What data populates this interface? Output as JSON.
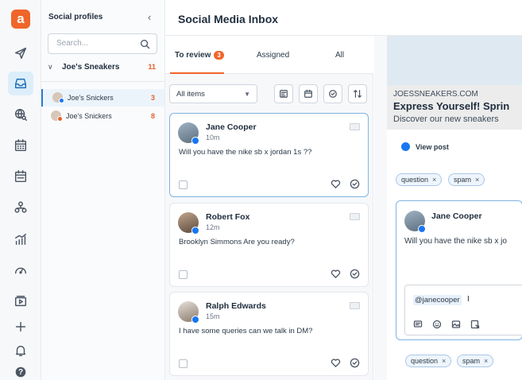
{
  "rail": {
    "logo": "a",
    "icons": [
      "send-icon",
      "inbox-icon",
      "globe-search-icon",
      "calendar-icon",
      "planner-icon",
      "team-icon",
      "analytics-icon",
      "gauge-icon",
      "media-icon",
      "plus-icon",
      "bell-icon",
      "help-icon"
    ],
    "active": "inbox-icon",
    "help_label": "?"
  },
  "profiles": {
    "title": "Social profiles",
    "search_placeholder": "Search...",
    "group": {
      "name": "Joe's Sneakers",
      "count": "11"
    },
    "items": [
      {
        "name": "Joe's Snickers",
        "count": "3",
        "network": "facebook"
      },
      {
        "name": "Joe's Snickers",
        "count": "8",
        "network": "instagram"
      }
    ]
  },
  "header": {
    "title": "Social Media Inbox"
  },
  "tabs": [
    {
      "label": "To review",
      "badge": "3"
    },
    {
      "label": "Assigned"
    },
    {
      "label": "All"
    }
  ],
  "filter": {
    "selected": "All items"
  },
  "messages": [
    {
      "name": "Jane Cooper",
      "time": "10m",
      "text": "Will you have the nike sb x jordan 1s ??"
    },
    {
      "name": "Robert Fox",
      "time": "12m",
      "text": "Brooklyn Simmons Are you ready?"
    },
    {
      "name": "Ralph Edwards",
      "time": "15m",
      "text": "I have some queries can we talk in DM?"
    }
  ],
  "detail": {
    "preview": {
      "domain": "JOESSNEAKERS.COM",
      "headline": "Express Yourself! Sprin",
      "subtitle": "Discover our new sneakers"
    },
    "view_post": "View post",
    "tags": [
      "question",
      "spam"
    ],
    "comment": {
      "name": "Jane Cooper",
      "text": "Will you have the nike sb x jo",
      "reply_mention": "@janecooper",
      "reply_cursor": "I"
    },
    "reply_tags": [
      "question",
      "spam"
    ]
  },
  "colors": {
    "accent": "#f0652a",
    "facebook": "#1877f2",
    "selected_border": "#7fb3e2"
  }
}
